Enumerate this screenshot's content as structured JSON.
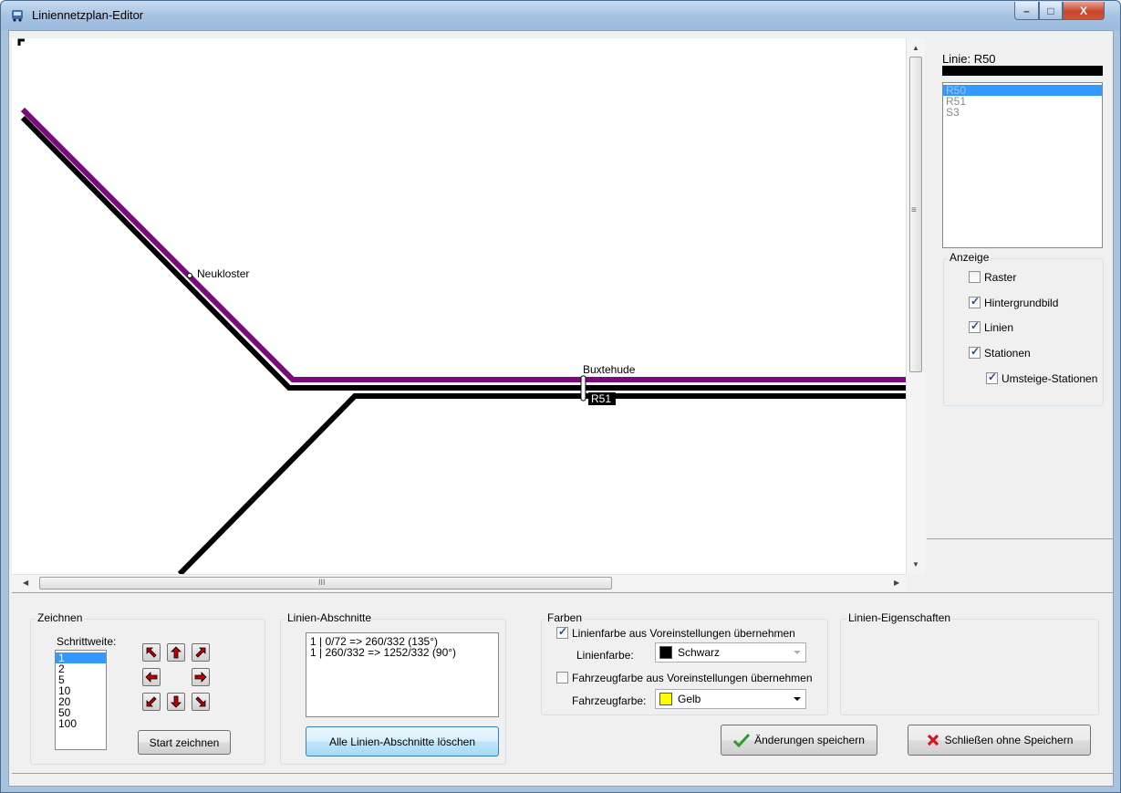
{
  "window": {
    "title": "Liniennetzplan-Editor",
    "min": "–",
    "max": "□",
    "close": "X"
  },
  "canvas": {
    "stations": [
      {
        "name": "Neukloster"
      },
      {
        "name": "Buxtehude"
      }
    ],
    "line_tag": "R51",
    "lines": [
      {
        "name": "R50",
        "color": "#000000"
      },
      {
        "name": "S3",
        "color": "#7b0a7e"
      },
      {
        "name": "R51",
        "color": "#000000"
      }
    ],
    "hscroll_grip": "III",
    "vscroll_grip": "≡"
  },
  "side": {
    "line_label": "Linie: R50",
    "line_color": "#000000",
    "lines_list": [
      "R50",
      "R51",
      "S3"
    ],
    "selected_line": "R50",
    "anzeige": {
      "title": "Anzeige",
      "options": [
        {
          "label": "Raster",
          "checked": false
        },
        {
          "label": "Hintergrundbild",
          "checked": true
        },
        {
          "label": "Linien",
          "checked": true
        },
        {
          "label": "Stationen",
          "checked": true
        },
        {
          "label": "Umsteige-Stationen",
          "checked": true
        }
      ]
    }
  },
  "zeichnen": {
    "title": "Zeichnen",
    "step_label": "Schrittweite:",
    "steps": [
      "1",
      "2",
      "5",
      "10",
      "20",
      "50",
      "100"
    ],
    "selected_step": "1",
    "start_button": "Start zeichnen",
    "arrows": [
      "arrow-up-left",
      "arrow-up",
      "arrow-up-right",
      "arrow-left",
      "arrow-right",
      "arrow-down-left",
      "arrow-down",
      "arrow-down-right"
    ]
  },
  "abschnitte": {
    "title": "Linien-Abschnitte",
    "items": [
      "1 | 0/72 => 260/332 (135°)",
      "1 | 260/332 => 1252/332 (90°)"
    ],
    "delete_button": "Alle Linien-Abschnitte löschen"
  },
  "farben": {
    "title": "Farben",
    "line_color_default": {
      "label": "Linienfarbe aus Voreinstellungen übernehmen",
      "checked": true
    },
    "line_color_label": "Linienfarbe:",
    "line_color_value": "Schwarz",
    "line_color_swatch": "#000000",
    "vehicle_color_default": {
      "label": "Fahrzeugfarbe aus Voreinstellungen übernehmen",
      "checked": false
    },
    "vehicle_color_label": "Fahrzeugfarbe:",
    "vehicle_color_value": "Gelb",
    "vehicle_color_swatch": "#ffff00"
  },
  "eigenschaften": {
    "title": "Linien-Eigenschaften"
  },
  "actions": {
    "save": "Änderungen speichern",
    "close": "Schließen ohne Speichern"
  }
}
